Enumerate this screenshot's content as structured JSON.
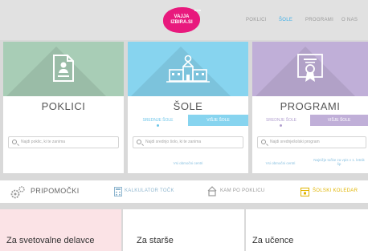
{
  "header": {
    "logo_text": "VAJJA IZBIRA.SI",
    "logo_badge": "beta",
    "nav": [
      {
        "label": "POKLICI",
        "active": false
      },
      {
        "label": "ŠOLE",
        "active": true
      },
      {
        "label": "PROGRAMI",
        "active": false
      },
      {
        "label": "O NAS",
        "active": false
      }
    ]
  },
  "cards": [
    {
      "title": "POKLICI",
      "search_placeholder": "Najdi poklic, ki te zanima",
      "color": "#a8cdb6",
      "icon": "document-icon"
    },
    {
      "title": "ŠOLE",
      "tabs": [
        {
          "label": "SREDNJE ŠOLE",
          "active": true
        },
        {
          "label": "VIŠJE ŠOLE",
          "active": false
        }
      ],
      "search_placeholder": "Najdi srednjo šolo, ki te zanima",
      "link": "Vsi območni centri",
      "color": "#87d4ef",
      "icon": "school-building-icon"
    },
    {
      "title": "PROGRAMI",
      "tabs": [
        {
          "label": "SREDNJE ŠOLE",
          "active": true
        },
        {
          "label": "VIŠJE ŠOLE",
          "active": false
        }
      ],
      "search_placeholder": "Najdi srednješolski program",
      "links": [
        "Vsi območni centri",
        "Najnižje točke za vpis v 1. letnik šp"
      ],
      "color": "#c0afd8",
      "icon": "certificate-icon"
    }
  ],
  "tools": {
    "title": "PRIPOMOČKI",
    "items": [
      {
        "label": "KALKULATOR TOČK",
        "icon": "calculator-icon"
      },
      {
        "label": "KAM PO POKLICU",
        "icon": "house-icon"
      },
      {
        "label": "ŠOLSKI KOLEDAR",
        "icon": "calendar-icon"
      }
    ]
  },
  "bottom": [
    {
      "label": "Za svetovalne delavce",
      "color": "#fbe3e6"
    },
    {
      "label": "Za starše",
      "color": "#ffffff"
    },
    {
      "label": "Za učence",
      "color": "#ffffff"
    }
  ]
}
